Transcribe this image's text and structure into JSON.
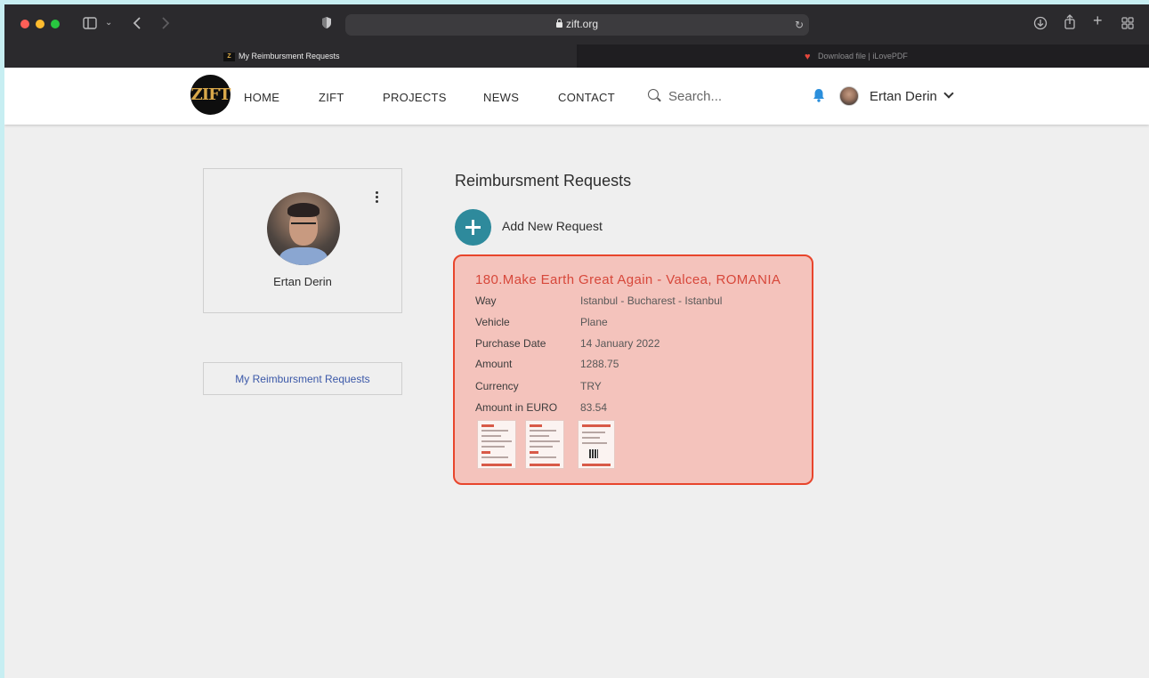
{
  "browser": {
    "url": "zift.org",
    "tabs": [
      {
        "label": "My Reimbursment Requests",
        "favicon": "zift-icon",
        "active": true
      },
      {
        "label": "Download file | iLovePDF",
        "favicon": "ilovepdf-heart-icon",
        "active": false
      }
    ],
    "colors": {
      "toolbar": "#2b2a2d",
      "red_light": "#fe5f57",
      "yellow_light": "#febc2e",
      "green_light": "#28c840"
    }
  },
  "site": {
    "logo_text": "ZIFT",
    "nav": [
      "HOME",
      "ZIFT",
      "PROJECTS",
      "NEWS",
      "CONTACT"
    ],
    "search_placeholder": "Search...",
    "user_name": "Ertan Derin"
  },
  "profile": {
    "name": "Ertan Derin",
    "my_requests_label": "My Reimbursment Requests"
  },
  "content": {
    "title": "Reimbursment Requests",
    "add_label": "Add New Request",
    "accent": "#2e8a9c",
    "request": {
      "title": "180.Make Earth Great Again - Valcea, ROMANIA",
      "fields": [
        {
          "label": "Way",
          "value": "Istanbul - Bucharest - Istanbul"
        },
        {
          "label": "Vehicle",
          "value": "Plane"
        },
        {
          "label": "Purchase Date",
          "value": "14 January 2022"
        },
        {
          "label": "Amount",
          "value": "1288.75"
        },
        {
          "label": "Currency",
          "value": "TRY"
        },
        {
          "label": "Amount in EURO",
          "value": "83.54"
        }
      ],
      "attachments": 3,
      "card_color": "#f4c3bc",
      "border_color": "#e8452c"
    }
  }
}
